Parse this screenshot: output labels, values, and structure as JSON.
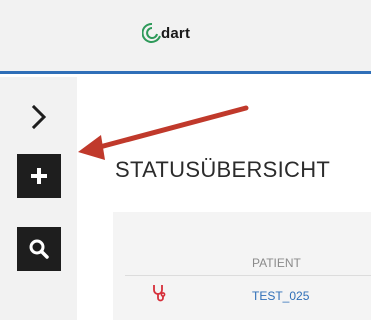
{
  "header": {
    "logo_text": "dart"
  },
  "sidebar": {
    "expand_icon": "chevron-right-icon",
    "add_icon": "plus-icon",
    "search_icon": "search-icon"
  },
  "main": {
    "title": "STATUSÜBERSICHT",
    "table": {
      "columns": [
        "PATIENT"
      ],
      "rows": [
        {
          "icon": "stethoscope-icon",
          "patient": "TEST_025"
        }
      ]
    }
  },
  "annotation": {
    "arrow_color": "#c0392b"
  },
  "colors": {
    "accent": "#2f6fb8",
    "logo_green": "#2e9a5a",
    "dark_button": "#1e1e1e",
    "status_red": "#d62f3a"
  }
}
